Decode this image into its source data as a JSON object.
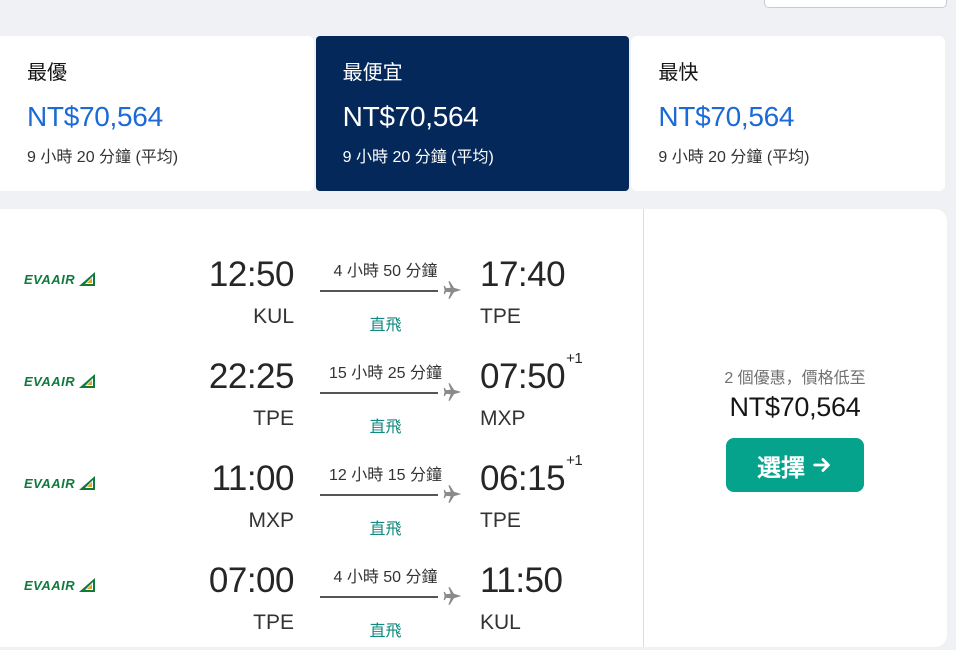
{
  "tabs": [
    {
      "label": "最優",
      "price": "NT$70,564",
      "duration": "9 小時 20 分鐘 (平均)"
    },
    {
      "label": "最便宜",
      "price": "NT$70,564",
      "duration": "9 小時 20 分鐘 (平均)"
    },
    {
      "label": "最快",
      "price": "NT$70,564",
      "duration": "9 小時 20 分鐘 (平均)"
    }
  ],
  "active_tab": 1,
  "legs": [
    {
      "airline": "EVAAIR",
      "dep_time": "12:50",
      "dep_code": "KUL",
      "duration": "4 小時 50 分鐘",
      "stops": "直飛",
      "arr_time": "17:40",
      "arr_day": "",
      "arr_code": "TPE"
    },
    {
      "airline": "EVAAIR",
      "dep_time": "22:25",
      "dep_code": "TPE",
      "duration": "15 小時 25 分鐘",
      "stops": "直飛",
      "arr_time": "07:50",
      "arr_day": "+1",
      "arr_code": "MXP"
    },
    {
      "airline": "EVAAIR",
      "dep_time": "11:00",
      "dep_code": "MXP",
      "duration": "12 小時 15 分鐘",
      "stops": "直飛",
      "arr_time": "06:15",
      "arr_day": "+1",
      "arr_code": "TPE"
    },
    {
      "airline": "EVAAIR",
      "dep_time": "07:00",
      "dep_code": "TPE",
      "duration": "4 小時 50 分鐘",
      "stops": "直飛",
      "arr_time": "11:50",
      "arr_day": "",
      "arr_code": "KUL"
    }
  ],
  "offer": {
    "count_text": "2 個優惠，價格低至",
    "price": "NT$70,564",
    "select_label": "選擇",
    "select_icon": "arrow-right-icon"
  },
  "colors": {
    "active_tab": "#05285a",
    "price_blue": "#1b6ad6",
    "direct_teal": "#128a7f",
    "select_button": "#05a28c",
    "eva_green": "#0f7a3c"
  }
}
